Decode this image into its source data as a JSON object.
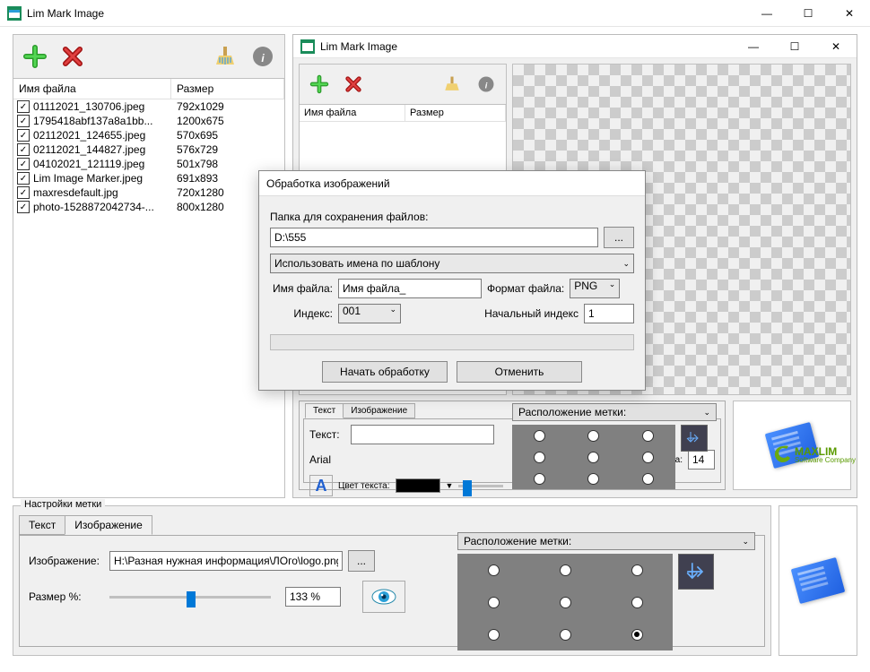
{
  "app": {
    "title": "Lim Mark Image"
  },
  "win_buttons": {
    "min": "—",
    "max": "☐",
    "close": "✕"
  },
  "toolbar": {
    "add": "+",
    "remove": "✕",
    "clean": "🧹",
    "info": "i"
  },
  "filelist": {
    "head_name": "Имя файла",
    "head_size": "Размер",
    "rows": [
      {
        "name": "01112021_130706.jpeg",
        "size": "792x1029"
      },
      {
        "name": "1795418abf137a8a1bb...",
        "size": "1200x675"
      },
      {
        "name": "02112021_124655.jpeg",
        "size": "570x695"
      },
      {
        "name": "02112021_144827.jpeg",
        "size": "576x729"
      },
      {
        "name": "04102021_121119.jpeg",
        "size": "501x798"
      },
      {
        "name": "Lim Image Marker.jpeg",
        "size": "691x893"
      },
      {
        "name": "maxresdefault.jpg",
        "size": "720x1280"
      },
      {
        "name": "photo-1528872042734-...",
        "size": "800x1280"
      }
    ]
  },
  "child": {
    "title": "Lim Mark Image"
  },
  "dialog": {
    "title": "Обработка изображений",
    "save_folder_lbl": "Папка для сохранения файлов:",
    "save_folder": "D:\\555",
    "browse": "...",
    "naming_mode": "Использовать имена по шаблону",
    "filename_lbl": "Имя файла:",
    "filename": "Имя файла_",
    "format_lbl": "Формат файла:",
    "format": "PNG",
    "index_lbl": "Индекс:",
    "index": "001",
    "start_index_lbl": "Начальный индекс",
    "start_index": "1",
    "start": "Начать обработку",
    "cancel": "Отменить"
  },
  "settings_inner": {
    "tab_text": "Текст",
    "tab_image": "Изображение",
    "text_lbl": "Текст:",
    "font": "Arial",
    "fontsize_lbl": "Размер шрифта:",
    "fontsize": "14",
    "color_lbl": "Цвет текста:",
    "pos_lbl": "Расположение метки:"
  },
  "settings_outer": {
    "group": "Настройки метки",
    "tab_text": "Текст",
    "tab_image": "Изображение",
    "image_lbl": "Изображение:",
    "image_path": "Н:\\Разная нужная информация\\ЛОго\\logo.png",
    "browse": "...",
    "size_lbl": "Размер %:",
    "size_val": "133 %",
    "pos_lbl": "Расположение метки:"
  },
  "brand": {
    "name": "MAXLIM",
    "sub": "Software Company"
  }
}
